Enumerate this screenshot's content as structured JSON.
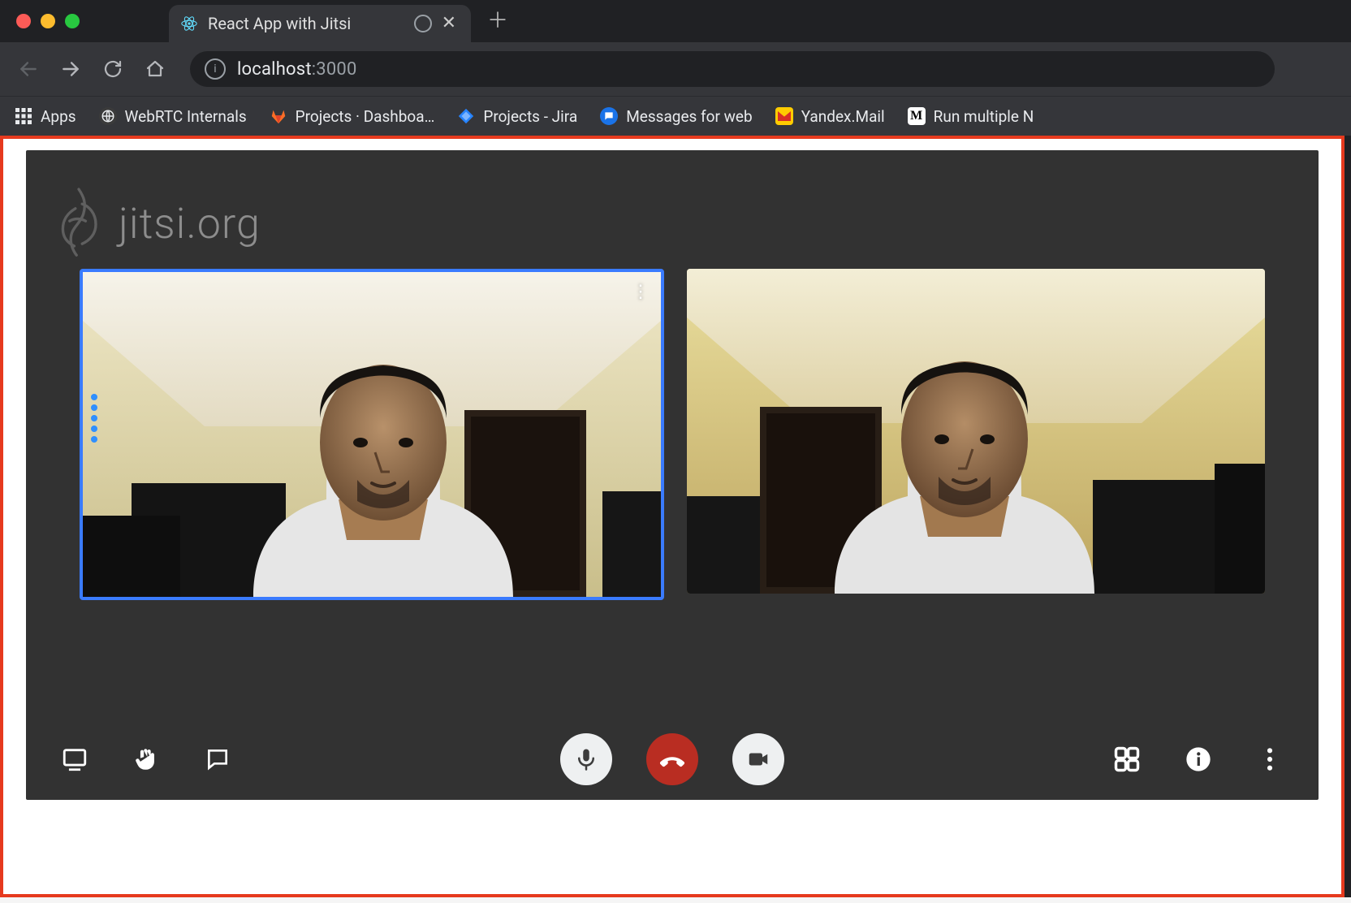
{
  "window": {
    "tab_title": "React App with Jitsi",
    "url_host": "localhost",
    "url_port": ":3000"
  },
  "bookmarks": {
    "apps": "Apps",
    "items": [
      {
        "label": "WebRTC Internals",
        "icon": "globe",
        "bg": "#3b3b3b",
        "fg": "#fff"
      },
      {
        "label": "Projects · Dashboa…",
        "icon": "gitlab",
        "bg": "transparent",
        "fg": "#fc6d26"
      },
      {
        "label": "Projects - Jira",
        "icon": "jira",
        "bg": "transparent",
        "fg": "#2684ff"
      },
      {
        "label": "Messages for web",
        "icon": "messages",
        "bg": "#1a73e8",
        "fg": "#fff"
      },
      {
        "label": "Yandex.Mail",
        "icon": "mail",
        "bg": "#ffcc00",
        "fg": "#d93025"
      },
      {
        "label": "Run multiple N",
        "icon": "medium",
        "bg": "#fff",
        "fg": "#000"
      }
    ]
  },
  "jitsi": {
    "brand": "jitsi.org",
    "toolbar_icons": {
      "screen_share": "desktop-icon",
      "raise_hand": "hand-icon",
      "chat": "chat-icon",
      "mic": "microphone-icon",
      "hangup": "phone-hangup-icon",
      "camera": "camera-icon",
      "tile_view": "tile-view-icon",
      "info": "info-icon",
      "more": "more-vertical-icon"
    }
  }
}
